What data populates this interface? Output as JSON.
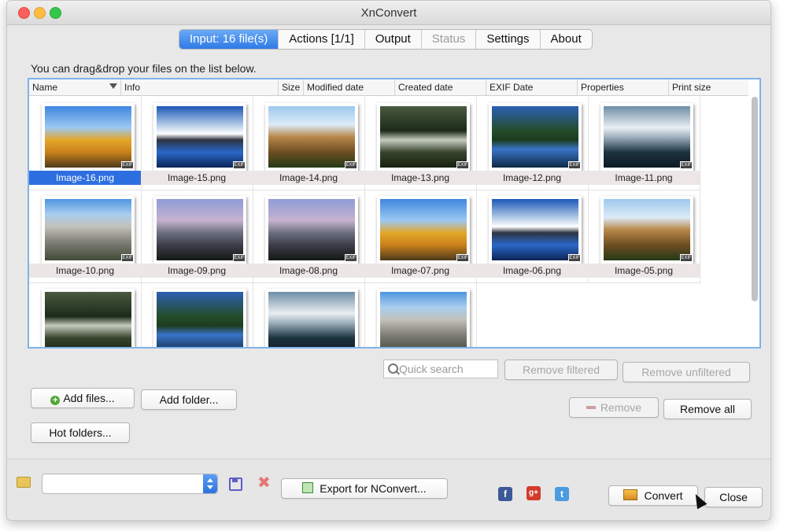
{
  "window": {
    "title": "XnConvert"
  },
  "tabs": [
    {
      "label": "Input: 16 file(s)",
      "active": true,
      "enabled": true
    },
    {
      "label": "Actions [1/1]",
      "active": false,
      "enabled": true
    },
    {
      "label": "Output",
      "active": false,
      "enabled": true
    },
    {
      "label": "Status",
      "active": false,
      "enabled": false
    },
    {
      "label": "Settings",
      "active": false,
      "enabled": true
    },
    {
      "label": "About",
      "active": false,
      "enabled": true
    }
  ],
  "input": {
    "hint": "You can drag&drop your files on the list below.",
    "columns": [
      "Name",
      "Info",
      "Size",
      "Modified date",
      "Created date",
      "EXIF Date",
      "Properties",
      "Print size"
    ],
    "files": [
      {
        "name": "Image-16.png",
        "selected": true,
        "scene": "autumn"
      },
      {
        "name": "Image-15.png",
        "selected": false,
        "scene": "lake"
      },
      {
        "name": "Image-14.png",
        "selected": false,
        "scene": "cliff"
      },
      {
        "name": "Image-13.png",
        "selected": false,
        "scene": "forest"
      },
      {
        "name": "Image-12.png",
        "selected": false,
        "scene": "reflection"
      },
      {
        "name": "Image-11.png",
        "selected": false,
        "scene": "mist"
      },
      {
        "name": "Image-10.png",
        "selected": false,
        "scene": "dome"
      },
      {
        "name": "Image-09.png",
        "selected": false,
        "scene": "halfdome"
      },
      {
        "name": "Image-08.png",
        "selected": false,
        "scene": "halfdome"
      },
      {
        "name": "Image-07.png",
        "selected": false,
        "scene": "autumn"
      },
      {
        "name": "Image-06.png",
        "selected": false,
        "scene": "lake"
      },
      {
        "name": "Image-05.png",
        "selected": false,
        "scene": "cliff"
      },
      {
        "name": "",
        "selected": false,
        "scene": "forest"
      },
      {
        "name": "",
        "selected": false,
        "scene": "reflection"
      },
      {
        "name": "",
        "selected": false,
        "scene": "mist"
      },
      {
        "name": "",
        "selected": false,
        "scene": "dome"
      }
    ],
    "badge": "EXIF",
    "search_placeholder": "Quick search",
    "remove_filtered_label": "Remove filtered",
    "remove_unfiltered_label": "Remove unfiltered",
    "add_files_label": "Add files...",
    "add_folder_label": "Add folder...",
    "remove_label": "Remove",
    "remove_all_label": "Remove all",
    "hot_folders_label": "Hot folders..."
  },
  "footer": {
    "export_label": "Export for NConvert...",
    "convert_label": "Convert",
    "close_label": "Close",
    "fb_glyph": "f",
    "gplus_glyph": "g+",
    "tw_glyph": "t"
  },
  "colors": {
    "accent": "#2f7ae6",
    "selection": "#2d6fe0",
    "list_border": "#7fb2ea"
  }
}
